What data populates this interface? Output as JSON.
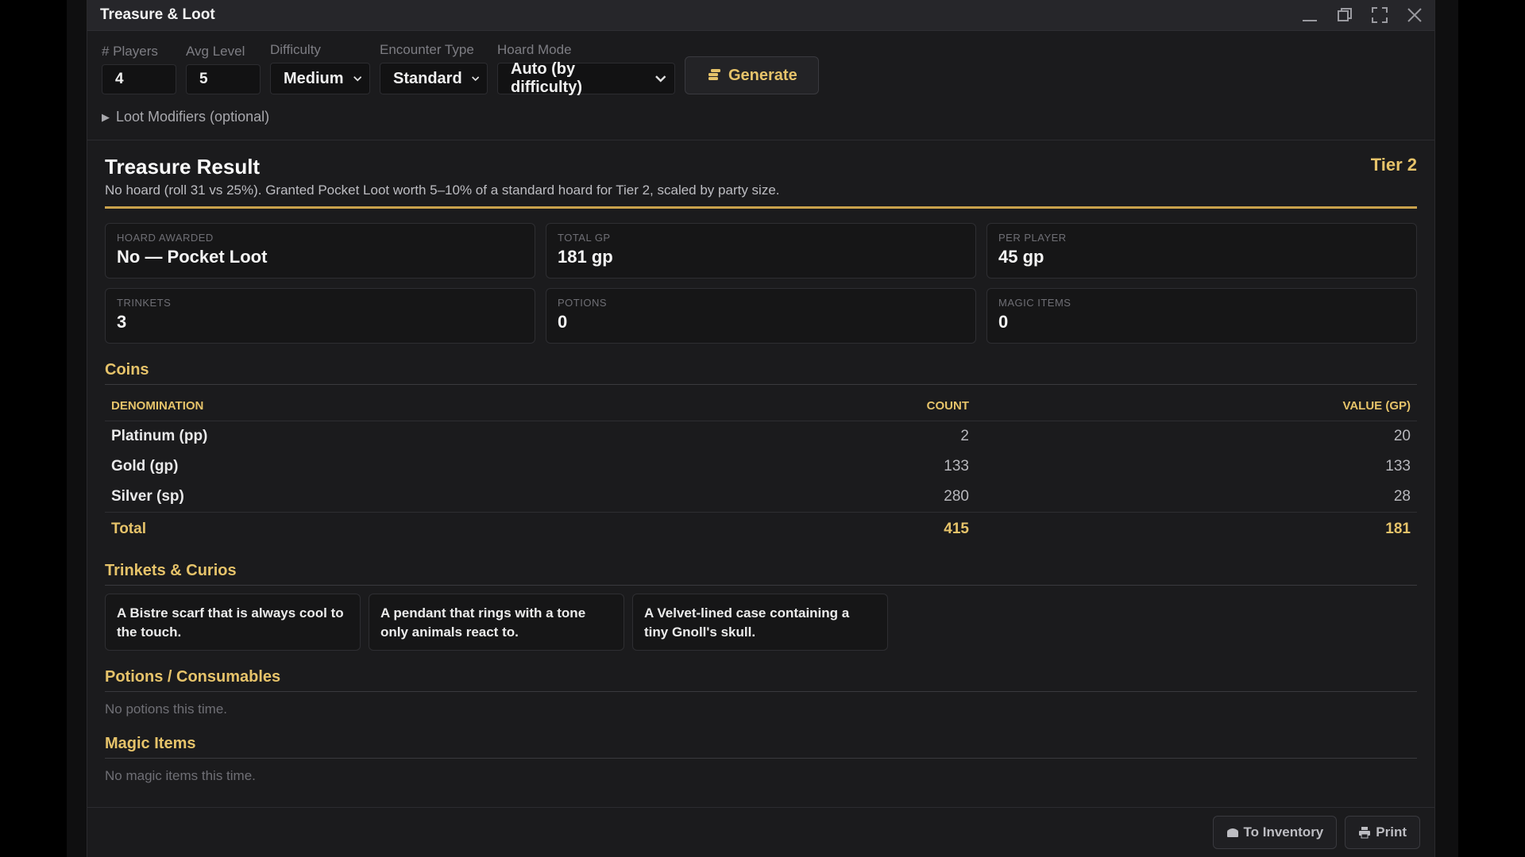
{
  "window": {
    "title": "Treasure & Loot"
  },
  "controls": {
    "players_label": "# Players",
    "players_value": "4",
    "avg_level_label": "Avg Level",
    "avg_level_value": "5",
    "difficulty_label": "Difficulty",
    "difficulty_value": "Medium",
    "encounter_label": "Encounter Type",
    "encounter_value": "Standard",
    "hoard_label": "Hoard Mode",
    "hoard_value": "Auto (by difficulty)",
    "generate_label": "Generate",
    "modifiers_label": "Loot Modifiers (optional)"
  },
  "result": {
    "title": "Treasure Result",
    "tier": "Tier 2",
    "subtitle": "No hoard (roll 31 vs 25%). Granted Pocket Loot worth 5–10% of a standard hoard for Tier 2, scaled by party size."
  },
  "stats": [
    {
      "label": "HOARD AWARDED",
      "value": "No — Pocket Loot"
    },
    {
      "label": "TOTAL GP",
      "value": "181 gp"
    },
    {
      "label": "PER PLAYER",
      "value": "45 gp"
    },
    {
      "label": "TRINKETS",
      "value": "3"
    },
    {
      "label": "POTIONS",
      "value": "0"
    },
    {
      "label": "MAGIC ITEMS",
      "value": "0"
    }
  ],
  "coins": {
    "title": "Coins",
    "headers": {
      "denomination": "Denomination",
      "count": "Count",
      "value": "Value (gp)"
    },
    "rows": [
      {
        "name": "Platinum (pp)",
        "count": "2",
        "value": "20"
      },
      {
        "name": "Gold (gp)",
        "count": "133",
        "value": "133"
      },
      {
        "name": "Silver (sp)",
        "count": "280",
        "value": "28"
      }
    ],
    "total": {
      "name": "Total",
      "count": "415",
      "value": "181"
    }
  },
  "trinkets": {
    "title": "Trinkets & Curios",
    "items": [
      "A Bistre scarf that is always cool to the touch.",
      "A pendant that rings with a tone only animals react to.",
      "A Velvet-lined case containing a tiny Gnoll's skull."
    ]
  },
  "potions": {
    "title": "Potions / Consumables",
    "empty": "No potions this time."
  },
  "magic": {
    "title": "Magic Items",
    "empty": "No magic items this time."
  },
  "footer": {
    "inventory_label": "To Inventory",
    "print_label": "Print"
  },
  "colors": {
    "accent": "#e6c36a",
    "rule": "#c9a24c",
    "background": "#1b1b1d"
  }
}
